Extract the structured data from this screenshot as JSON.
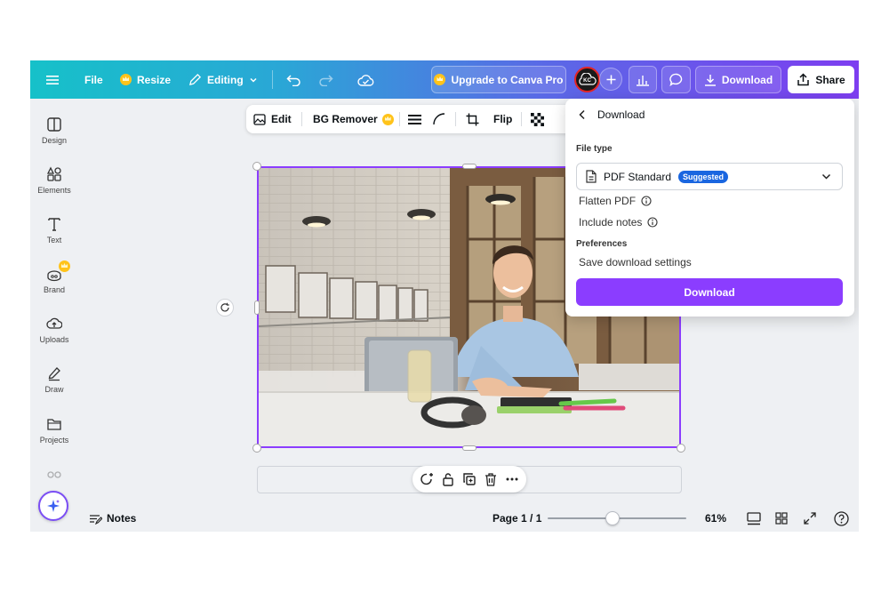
{
  "topbar": {
    "file": "File",
    "resize": "Resize",
    "editing": "Editing",
    "upgrade": "Upgrade to Canva Pro",
    "download": "Download",
    "share": "Share",
    "avatar_initials": "KC"
  },
  "sidebar": {
    "items": [
      {
        "label": "Design",
        "icon": "layout-icon"
      },
      {
        "label": "Elements",
        "icon": "shapes-icon"
      },
      {
        "label": "Text",
        "icon": "text-icon"
      },
      {
        "label": "Brand",
        "icon": "brand-icon"
      },
      {
        "label": "Uploads",
        "icon": "cloud-upload-icon"
      },
      {
        "label": "Draw",
        "icon": "pen-icon"
      },
      {
        "label": "Projects",
        "icon": "folder-icon"
      }
    ]
  },
  "toolbar": {
    "edit": "Edit",
    "bg_remover": "BG Remover",
    "flip": "Flip"
  },
  "download_panel": {
    "title": "Download",
    "file_type_label": "File type",
    "selected_type": "PDF Standard",
    "suggested_badge": "Suggested",
    "flatten_pdf": "Flatten PDF",
    "include_notes": "Include notes",
    "preferences_label": "Preferences",
    "save_settings": "Save download settings",
    "download_button": "Download"
  },
  "bottombar": {
    "notes": "Notes",
    "page": "Page 1 / 1",
    "zoom": "61%",
    "zoom_fraction": 0.47
  },
  "colors": {
    "accent": "#8b3dff",
    "badge": "#1a66e0",
    "crown": "#ffc31a"
  }
}
